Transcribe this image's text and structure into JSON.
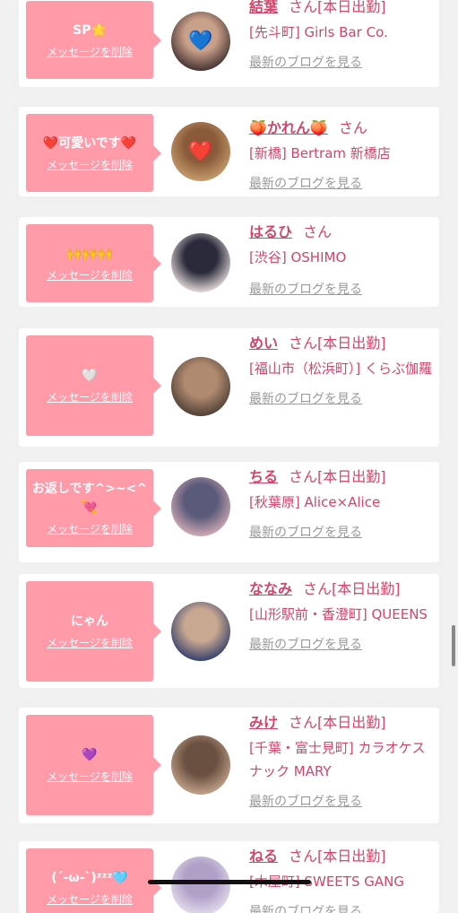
{
  "cards": [
    {
      "message": "SP🌟",
      "delete_label": "メッセージを削除",
      "name": "結葉",
      "honorific": "さん",
      "status": "[本日出勤]",
      "shop": "[先斗町] Girls Bar Co.",
      "blog_label": "最新のブログを見る",
      "avatar_colors": [
        "#3a2a2a",
        "#c9a08a"
      ],
      "avatar_icon": "blue-heart"
    },
    {
      "message": "❤️可愛いです❤️",
      "delete_label": "メッセージを削除",
      "name": "🍑かれん🍑",
      "honorific": "さん",
      "status": "",
      "shop": "[新橋] Bertram 新橋店",
      "blog_label": "最新のブログを見る",
      "avatar_colors": [
        "#caa070",
        "#8a5a3a"
      ],
      "avatar_icon": "red-heart"
    },
    {
      "message": "🙌🙌🙌",
      "delete_label": "メッセージを削除",
      "name": "はるひ",
      "honorific": "さん",
      "status": "",
      "shop": "[渋谷] OSHIMO",
      "blog_label": "最新のブログを見る",
      "avatar_colors": [
        "#f2e6e6",
        "#2a2a3a"
      ],
      "avatar_icon": ""
    },
    {
      "message": "🤍",
      "delete_label": "メッセージを削除",
      "name": "めい",
      "honorific": "さん",
      "status": "[本日出勤]",
      "shop": "[福山市（松浜町）] くらぶ伽羅",
      "blog_label": "最新のブログを見る",
      "avatar_colors": [
        "#4a3a30",
        "#b08a70"
      ],
      "avatar_icon": ""
    },
    {
      "message": "お返しです^>~<^💘",
      "delete_label": "メッセージを削除",
      "name": "ちる",
      "honorific": "さん",
      "status": "[本日出勤]",
      "shop": "[秋葉原] Alice×Alice",
      "blog_label": "最新のブログを見る",
      "avatar_colors": [
        "#d8b0b8",
        "#5a5a7a"
      ],
      "avatar_icon": ""
    },
    {
      "message": "にゃん",
      "delete_label": "メッセージを削除",
      "name": "ななみ",
      "honorific": "さん",
      "status": "[本日出勤]",
      "shop": "[山形駅前・香澄町] QUEENS",
      "blog_label": "最新のブログを見る",
      "avatar_colors": [
        "#2a3a6a",
        "#c8a890"
      ],
      "avatar_icon": ""
    },
    {
      "message": "💜",
      "delete_label": "メッセージを削除",
      "name": "みけ",
      "honorific": "さん",
      "status": "[本日出勤]",
      "shop": "[千葉・富士見町] カラオケスナック MARY",
      "blog_label": "最新のブログを見る",
      "avatar_colors": [
        "#c8a890",
        "#6a5040"
      ],
      "avatar_icon": ""
    },
    {
      "message": "(´-ω-`)ᶻᶻᶻ🩵",
      "delete_label": "メッセージを削除",
      "name": "ねる",
      "honorific": "さん",
      "status": "[本日出勤]",
      "shop": "[木屋町] SWEETS GANG",
      "blog_label": "最新のブログを見る",
      "avatar_colors": [
        "#e8e0ee",
        "#b0a0c8"
      ],
      "avatar_icon": ""
    }
  ]
}
